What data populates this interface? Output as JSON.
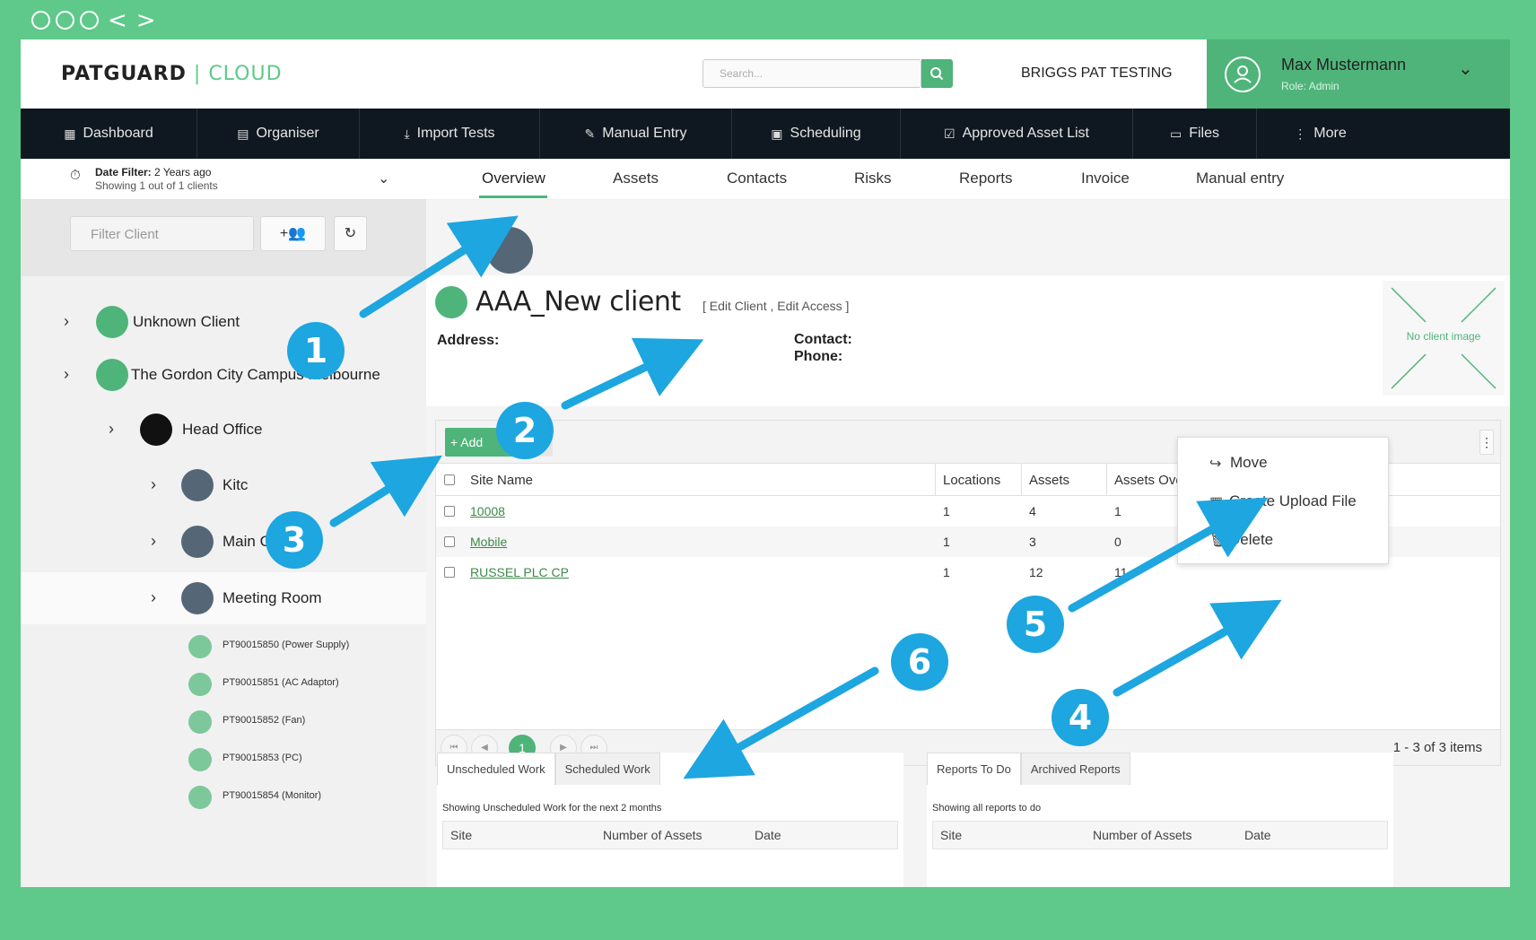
{
  "window": {
    "nav_back": "<",
    "nav_forward": ">"
  },
  "header": {
    "logo_a": "PATGUARD",
    "logo_sep": " | ",
    "logo_b": "CLOUD",
    "search_placeholder": "Search...",
    "company": "BRIGGS PAT TESTING",
    "user_name": "Max Mustermann",
    "user_role": "Role: Admin"
  },
  "nav": [
    {
      "label": "Dashboard",
      "icon": "grid-icon"
    },
    {
      "label": "Organiser",
      "icon": "building-icon"
    },
    {
      "label": "Import Tests",
      "icon": "download-icon"
    },
    {
      "label": "Manual Entry",
      "icon": "edit-icon"
    },
    {
      "label": "Scheduling",
      "icon": "calendar-icon"
    },
    {
      "label": "Approved Asset List",
      "icon": "checklist-icon"
    },
    {
      "label": "Files",
      "icon": "file-icon"
    },
    {
      "label": "More",
      "icon": "more-vertical-icon"
    }
  ],
  "left": {
    "date_filter_label": "Date Filter:",
    "date_filter_value": " 2 Years ago",
    "showing": "Showing 1 out of 1 clients",
    "filter_placeholder": "Filter Client",
    "tree": [
      {
        "label": "Unknown Client"
      },
      {
        "label": "The Gordon City Campus Melbourne"
      },
      {
        "label": "Head Office"
      },
      {
        "label": "Kitc"
      },
      {
        "label": "Main Office"
      },
      {
        "label": "Meeting Room"
      }
    ],
    "assets": [
      "PT90015850 (Power Supply)",
      "PT90015851 (AC Adaptor)",
      "PT90015852 (Fan)",
      "PT90015853 (PC)",
      "PT90015854 (Monitor)"
    ]
  },
  "tabs": [
    "Overview",
    "Assets",
    "Contacts",
    "Risks",
    "Reports",
    "Invoice",
    "Manual entry"
  ],
  "client": {
    "name": "AAA_New client",
    "edit_links": "[ Edit Client , Edit Access ]",
    "address_label": "Address:",
    "contact_label": "Contact:",
    "phone_label": "Phone:",
    "no_image": "No client image"
  },
  "grid": {
    "add_label": "+ Add",
    "columns": [
      "Site Name",
      "Locations",
      "Assets",
      "Assets Ove"
    ],
    "rows": [
      {
        "site": "10008",
        "locations": "1",
        "assets": "4",
        "over": "1"
      },
      {
        "site": "Mobile",
        "locations": "1",
        "assets": "3",
        "over": "0"
      },
      {
        "site": "RUSSEL PLC CP",
        "locations": "1",
        "assets": "12",
        "over": "11"
      }
    ],
    "current_page": "1",
    "items_text": "1 - 3 of 3 items"
  },
  "menu": [
    {
      "label": "Move",
      "icon": "share-arrow-icon"
    },
    {
      "label": "Create Upload File",
      "icon": "table-icon"
    },
    {
      "label": "Delete",
      "icon": "trash-icon"
    }
  ],
  "work": {
    "tab_unscheduled": "Unscheduled Work",
    "tab_scheduled": "Scheduled Work",
    "note": "Showing Unscheduled Work for the next 2 months",
    "cols": [
      "Site",
      "Number of Assets",
      "Date"
    ]
  },
  "reports": {
    "tab_todo": "Reports To Do",
    "tab_archived": "Archived Reports",
    "note": "Showing all reports to do",
    "cols": [
      "Site",
      "Number of Assets",
      "Date"
    ]
  },
  "callouts": [
    "1",
    "2",
    "3",
    "4",
    "5",
    "6"
  ],
  "colors": {
    "brand_green": "#4fb47a",
    "frame_green": "#5ec98a",
    "nav_dark": "#0f1820",
    "callout_blue": "#1da6e0"
  }
}
